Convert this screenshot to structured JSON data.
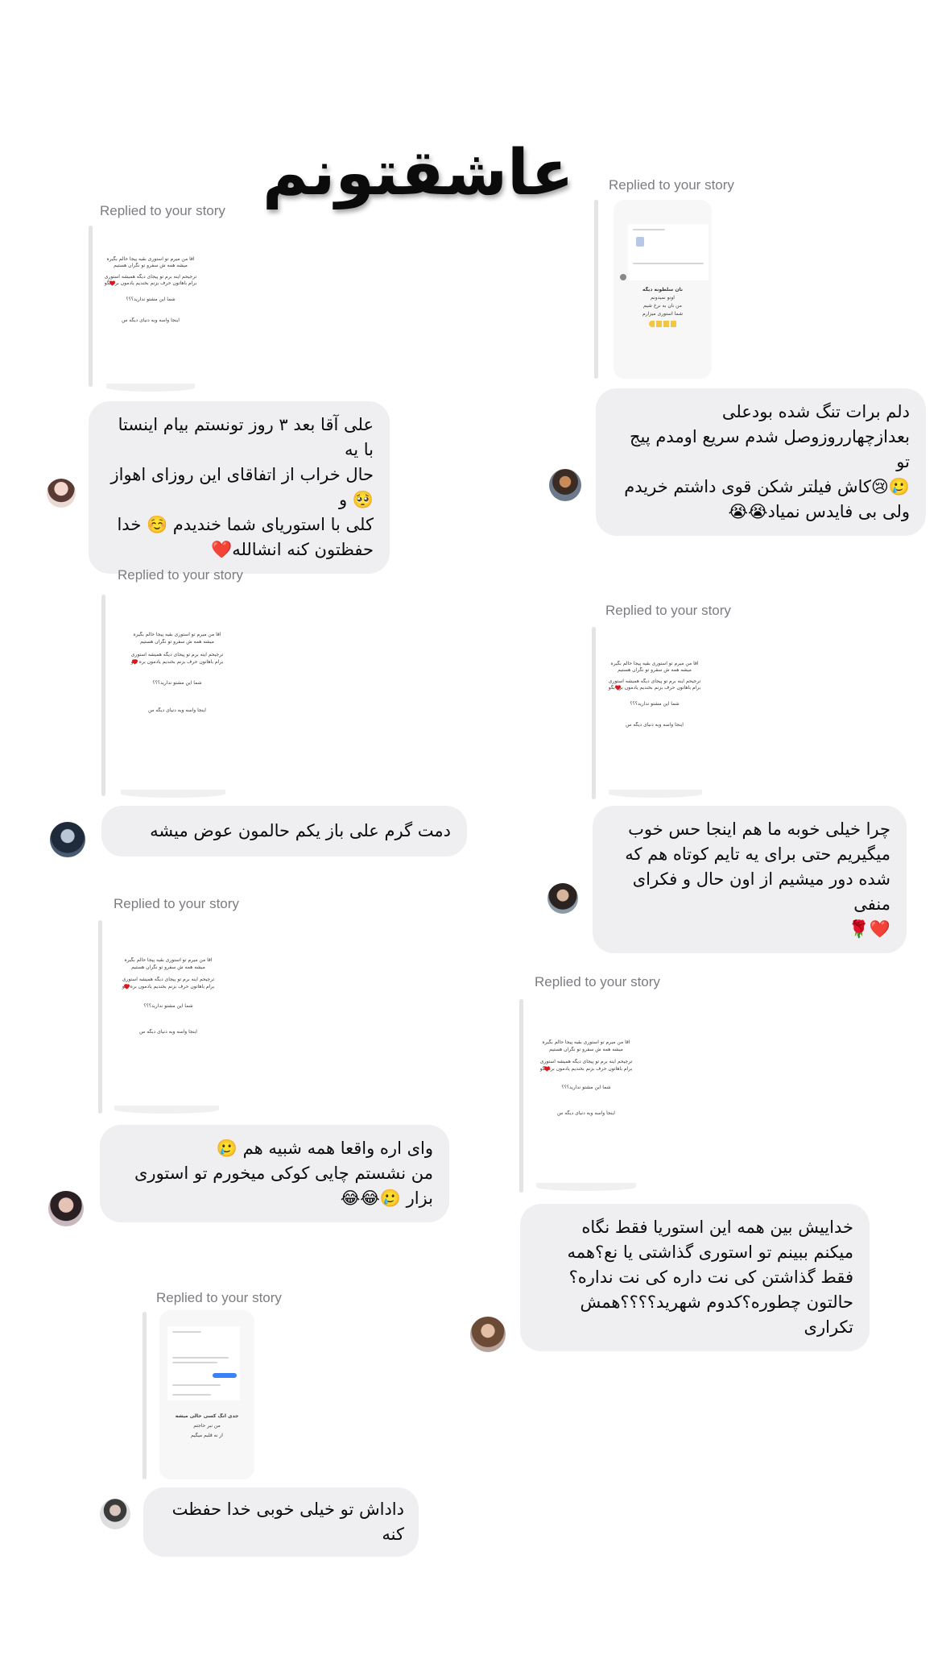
{
  "title": {
    "text": "عاشقتونم",
    "icon": "red-heart"
  },
  "reply_label": "Replied to your story",
  "story_snippet": {
    "line1": "اقا من میرم تو استوری بقیه پیجا حالم بگیره",
    "line2": "میشه همه ش سفرو تو نگران هستیم",
    "line3": "ترجیحم اینه برم تو پیجای دیگه همیشه استوری",
    "line4": "برام باهاتون حرف بزنم بخندیم یادمون بره بگو",
    "line5": "شما این مشتو ندارید؟؟؟",
    "line6": "اینجا واسه وبه دنیای دیگه س"
  },
  "story_card_top_right": {
    "line1": "نان سلطونه دیگه",
    "line2": "اونو نمیدونم",
    "line3": "من نان به نرخ شیم",
    "line4": "شما استوری میزارم"
  },
  "story_card_bottom": {
    "line1": "جدی انگ کسی حالی میشه",
    "line2": "من نبر حاجتم",
    "line3": "از نه قلبم میگیم"
  },
  "messages": [
    {
      "id": "m1",
      "text": "علی آقا بعد ۳ روز تونستم بیام اینستا با یه\nحال خراب از اتفاقای این روزای اهواز🥺 و\nکلی با استوریای شما خندیدم ☺️ خدا\nحفظتون کنه انشالله❤️"
    },
    {
      "id": "m2",
      "text": "دلم برات تنگ شده بودعلی\nبعدازچهارروزوصل شدم سریع اومدم پیج تو\n🥲😢کاش فیلتر شکن قوی داشتم خریدم\nولی بی فایدس نمیاد😭😭"
    },
    {
      "id": "m3",
      "text": "دمت گرم علی باز یکم حالمون عوض میشه"
    },
    {
      "id": "m4",
      "text": "چرا خیلی خوبه ما هم اینجا حس خوب\nمیگیریم حتی برای یه تایم کوتاه هم که\nشده دور میشیم از اون حال و فکرای منفی\n❤️🌹"
    },
    {
      "id": "m5",
      "text": "وای اره واقعا همه شبیه هم 🥲\nمن نشستم چایی کوکی میخورم تو استوری\nبزار 🥲😂😂"
    },
    {
      "id": "m6",
      "text": "خداییش بین همه این استوریا فقط نگاه\nمیکنم ببینم تو استوری گذاشتی یا نع؟همه\nفقط گذاشتن کی نت داره کی نت نداره؟\nحالتون چطوره؟کدوم شهرید؟؟؟؟همش\nتکراری"
    },
    {
      "id": "m7",
      "text": "داداش تو خیلی خوبی خدا حفظت کنه"
    }
  ],
  "colors": {
    "bubble": "#efeff1",
    "reply_label": "#7c7c82",
    "story_line": "#e4e4e6",
    "heart": "#e0161e"
  }
}
